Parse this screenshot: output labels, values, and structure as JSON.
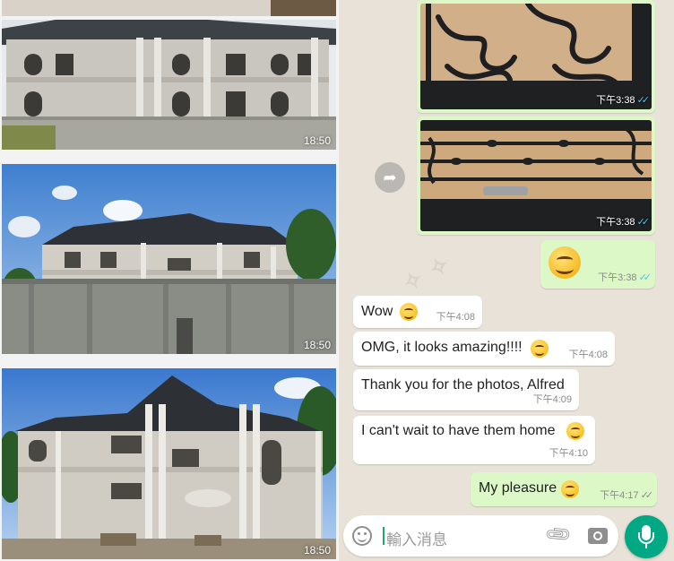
{
  "photos": [
    {
      "time": "18:50"
    },
    {
      "time": "18:50"
    },
    {
      "time": "18:50"
    }
  ],
  "chat": {
    "image_messages": [
      {
        "time": "下午3:38"
      },
      {
        "time": "下午3:38"
      }
    ],
    "messages": [
      {
        "side": "out",
        "text": "",
        "time": "下午3:38"
      },
      {
        "side": "in",
        "text": "Wow",
        "time": "下午4:08"
      },
      {
        "side": "in",
        "text": "OMG, it looks amazing!!!!",
        "time": "下午4:08"
      },
      {
        "side": "in",
        "text": "Thank you for the photos, Alfred",
        "time": "下午4:09"
      },
      {
        "side": "in",
        "text": "I can't wait to have them home",
        "time": "下午4:10"
      },
      {
        "side": "out",
        "text": "My pleasure",
        "time": "下午4:17"
      }
    ],
    "input": {
      "placeholder": "輸入消息"
    }
  },
  "colors": {
    "outgoing": "#dcf8c6",
    "incoming": "#ffffff",
    "background": "#e8e2d8",
    "read_ticks": "#4fc3f7",
    "mic": "#00a884"
  },
  "icons": [
    "forward-icon",
    "emoji-icon",
    "attach-icon",
    "camera-icon",
    "mic-icon",
    "read-ticks-icon"
  ]
}
